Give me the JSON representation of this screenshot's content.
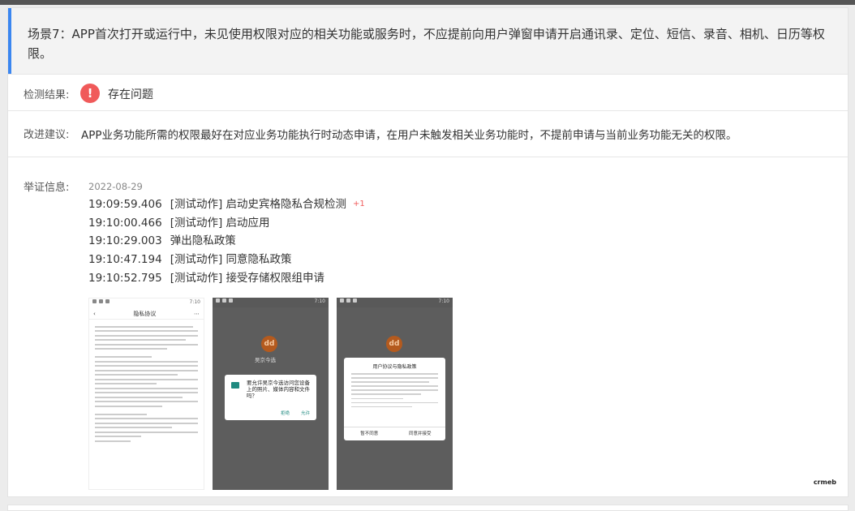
{
  "scene": {
    "text": "场景7：APP首次打开或运行中，未见使用权限对应的相关功能或服务时，不应提前向用户弹窗申请开启通讯录、定位、短信、录音、相机、日历等权限。"
  },
  "result": {
    "label": "检测结果:",
    "icon": "!",
    "text": "存在问题",
    "color": "#f05a5a"
  },
  "suggestion": {
    "label": "改进建议:",
    "text": "APP业务功能所需的权限最好在对应业务功能执行时动态申请，在用户未触发相关业务功能时，不提前申请与当前业务功能无关的权限。"
  },
  "evidence": {
    "label": "举证信息:",
    "date": "2022-08-29",
    "logs": [
      {
        "time": "19:09:59.406",
        "text": "[测试动作] 启动史宾格隐私合规检测",
        "badge": "+1"
      },
      {
        "time": "19:10:00.466",
        "text": "[测试动作] 启动应用",
        "badge": ""
      },
      {
        "time": "19:10:29.003",
        "text": "弹出隐私政策",
        "badge": ""
      },
      {
        "time": "19:10:47.194",
        "text": "[测试动作] 同意隐私政策",
        "badge": ""
      },
      {
        "time": "19:10:52.795",
        "text": "[测试动作] 接受存储权限组申请",
        "badge": ""
      }
    ]
  },
  "screenshots": {
    "status_time": "7:10",
    "s1": {
      "title": "隐私协议",
      "back": "‹",
      "more": "⋯"
    },
    "s2": {
      "logo": "dd",
      "app_name": "吴京今选",
      "dialog_text": "要允许吴京今选访问您设备上的照片、媒体内容和文件吗？",
      "deny": "拒绝",
      "allow": "允许"
    },
    "s3": {
      "logo": "dd",
      "dialog_title": "用户协议与隐私政策",
      "reject": "暂不同意",
      "accept": "同意并接受"
    }
  },
  "watermark": "crmeb",
  "icons": {
    "alert": "exclamation-icon",
    "folder": "folder-icon",
    "back": "back-arrow-icon",
    "more": "more-icon",
    "logo": "app-logo-icon"
  }
}
